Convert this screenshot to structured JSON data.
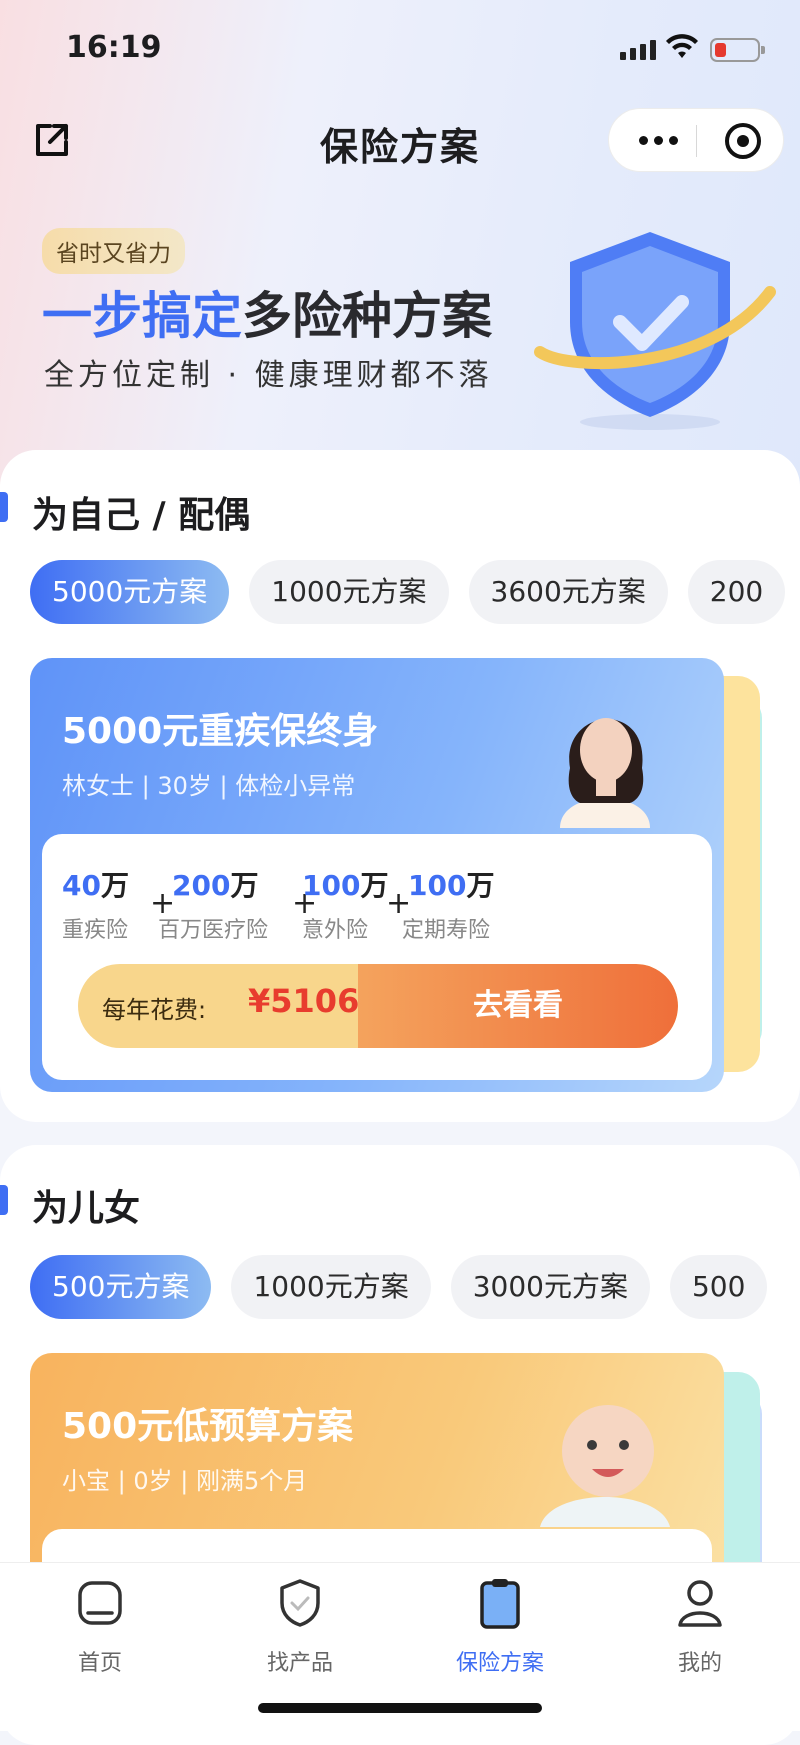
{
  "status_bar": {
    "time": "16:19"
  },
  "nav": {
    "title": "保险方案"
  },
  "hero": {
    "badge": "省时又省力",
    "title_blue": "一步搞定",
    "title_dark": "多险种方案",
    "subtitle": "全方位定制 · 健康理财都不落"
  },
  "section_self": {
    "title": "为自己 / 配偶",
    "tabs": [
      "5000元方案",
      "1000元方案",
      "3600元方案",
      "200"
    ],
    "active_tab": 0,
    "card": {
      "title": "5000元重疾保终身",
      "subtitle": "林女士 | 30岁 | 体检小异常",
      "coverages": [
        {
          "amount": "40",
          "unit": "万",
          "name": "重疾险"
        },
        {
          "amount": "200",
          "unit": "万",
          "name": "百万医疗险"
        },
        {
          "amount": "100",
          "unit": "万",
          "name": "意外险"
        },
        {
          "amount": "100",
          "unit": "万",
          "name": "定期寿险"
        }
      ],
      "plus": "+",
      "price_label": "每年花费:",
      "price": "¥5106",
      "cta": "去看看"
    }
  },
  "section_kids": {
    "title": "为儿女",
    "tabs": [
      "500元方案",
      "1000元方案",
      "3000元方案",
      "500"
    ],
    "active_tab": 0,
    "card": {
      "title": "500元低预算方案",
      "subtitle": "小宝 | 0岁 | 刚满5个月"
    }
  },
  "tabbar": {
    "items": [
      {
        "label": "首页",
        "icon": "home-icon"
      },
      {
        "label": "找产品",
        "icon": "shield-icon"
      },
      {
        "label": "保险方案",
        "icon": "clipboard-icon"
      },
      {
        "label": "我的",
        "icon": "user-icon"
      }
    ],
    "active": 2
  },
  "colors": {
    "accent": "#3f6ef3",
    "price": "#e83c2e",
    "cta": "#ef6f3a"
  }
}
